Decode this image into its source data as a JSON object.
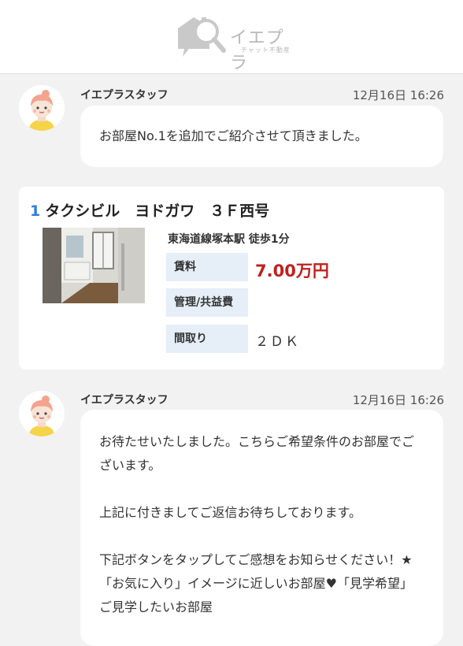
{
  "header": {
    "logo_text": "イエプラ",
    "logo_subtext": "チャット不動産"
  },
  "messages": [
    {
      "sender": "イエプラスタッフ",
      "timestamp": "12月16日 16:26",
      "text": "お部屋No.1を追加でご紹介させて頂きました。"
    },
    {
      "sender": "イエプラスタッフ",
      "timestamp": "12月16日 16:26",
      "paragraphs": [
        "お待たせいたしました。こちらご希望条件のお部屋でございます。",
        "上記に付きましてご返信お待ちしております。",
        "下記ボタンをタップしてご感想をお知らせください！★「お気に入り」イメージに近しいお部屋♥「見学希望」ご見学したいお部屋"
      ]
    }
  ],
  "property_card": {
    "number": "1",
    "name": "タクシビル　ヨドガワ　３Ｆ西号",
    "station": "東海道線塚本駅 徒歩1分",
    "rent_label": "賃料",
    "rent_value": "7.00万円",
    "management_label": "管理/共益費",
    "management_value": "",
    "layout_label": "間取り",
    "layout_value": "２ＤＫ"
  },
  "colors": {
    "background": "#f2f2f2",
    "accent_blue": "#2e7ed6",
    "rent_red": "#c0201f",
    "label_bg": "#e6eef8"
  }
}
